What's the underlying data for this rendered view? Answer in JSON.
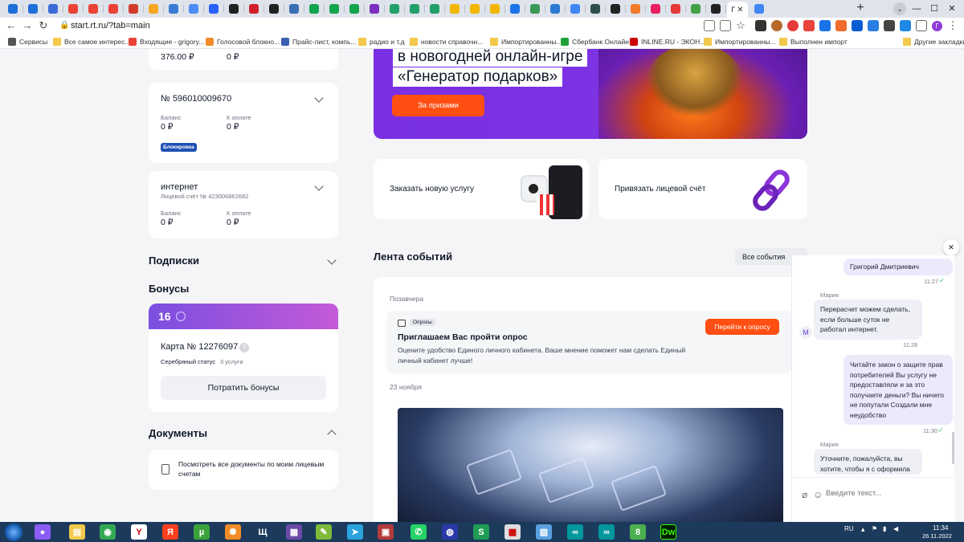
{
  "browser": {
    "url": "start.rt.ru/?tab=main",
    "active_tab_letter": "Г",
    "new_tab_label": "+",
    "tab_menu_label": "⌄",
    "win_min": "—",
    "win_max": "☐",
    "win_close": "✕",
    "avatar_letter": "Г",
    "tab_colors": [
      "#1d6fd8",
      "#1d6fd8",
      "#3b6bd4",
      "#ea4335",
      "#ea4335",
      "#ea4335",
      "#d23b2a",
      "#f5a623",
      "#3a7bd5",
      "#4c8bf5",
      "#2962ff",
      "#222222",
      "#d21f2c",
      "#222222",
      "#3c6eb4",
      "#14a44d",
      "#14a44d",
      "#14a44d",
      "#7b2fbf",
      "#22a06b",
      "#22a06b",
      "#22a06b",
      "#f2b500",
      "#f2b500",
      "#f2b500",
      "#1a73e8",
      "#3a9a55",
      "#2b7bd3",
      "#4285f4",
      "#2f4f4f",
      "#222222",
      "#f27b2a",
      "#e91e63",
      "#e53935",
      "#43a047",
      "#222222"
    ],
    "bookmarks": [
      {
        "label": "Сервисы"
      },
      {
        "label": "Все самое интерес..."
      },
      {
        "label": "Входящие - grigory..."
      },
      {
        "label": "Голосовой блокно..."
      },
      {
        "label": "Прайс-лист, компь..."
      },
      {
        "label": "радио и т.д"
      },
      {
        "label": "новости справочн..."
      },
      {
        "label": "Импортированны..."
      },
      {
        "label": "Сбербанк Онлайн"
      },
      {
        "label": "INLINE.RU - ЭКОН..."
      },
      {
        "label": "Импортированны..."
      },
      {
        "label": "Выполнен импорт"
      },
      {
        "label": "Другие закладки"
      }
    ]
  },
  "sidebar": {
    "acc0": {
      "balance": "376.00 ₽",
      "due": "0 ₽"
    },
    "acc1": {
      "title": "№ 596010009670",
      "balance_label": "Баланс",
      "due_label": "К оплате",
      "balance": "0 ₽",
      "due": "0 ₽",
      "badge": "Блокировка"
    },
    "acc2": {
      "title": "интернет",
      "subtitle": "Лицевой счёт № 423006862682",
      "balance_label": "Баланс",
      "due_label": "К оплате",
      "balance": "0 ₽",
      "due": "0 ₽"
    },
    "subscriptions": "Подписки",
    "bonuses": {
      "title": "Бонусы",
      "points": "16",
      "card": "Карта № 12276097",
      "help": "?",
      "status_label": "Серебряный статус",
      "status_value": "3 услуги",
      "spend_button": "Потратить бонусы"
    },
    "documents": {
      "title": "Документы",
      "link": "Посмотреть все документы по моим лицевым счетам"
    }
  },
  "promo": {
    "line1": "в новогодней онлайн-игре",
    "line2": "«Генератор подарков»",
    "button": "За призами"
  },
  "services": {
    "order": "Заказать новую услугу",
    "link_account": "Привязать лицевой счёт"
  },
  "feed": {
    "title": "Лента событий",
    "all_events": "Все события",
    "arrow": "→",
    "day1": "Позавчера",
    "survey": {
      "tag": "Опросы",
      "title": "Приглашаем Вас пройти опрос",
      "text": "Оцените удобство Единого личного кабинета. Ваше мнение поможет нам сделать Единый личный кабинет лучше!",
      "button": "Перейти к опросу"
    },
    "day2": "23 ноября"
  },
  "chat": {
    "close": "✕",
    "messages": [
      {
        "type": "out",
        "text": "Григорий Дмитриевич",
        "time": "11:27"
      },
      {
        "type": "in",
        "sender": "Мария",
        "text": "Перерасчет можем сделать, если больше суток не работал интернет.",
        "time": "11:28"
      },
      {
        "type": "out",
        "text": "Читайте закон о защите прав потребителей Вы услугу не предоставляли и за это получаете деньги? Вы ничего не попутали Создали мне неудобство",
        "time": "11:30"
      },
      {
        "type": "in",
        "sender": "Мария",
        "text": "Уточните, пожалуйста, вы хотите, чтобы я с оформила",
        "time": ""
      }
    ],
    "operator_initial": "М",
    "input_placeholder": "Введите текст..."
  },
  "taskbar": {
    "lang": "RU",
    "time": "11:34",
    "date": "26.11.2022",
    "icons": [
      {
        "name": "alice-icon",
        "color": "#8b5cf6",
        "glyph": "●"
      },
      {
        "name": "explorer-icon",
        "color": "#f3c94b",
        "glyph": "▤"
      },
      {
        "name": "chrome-icon",
        "color": "#34a853",
        "glyph": "◉"
      },
      {
        "name": "yandex-browser-icon",
        "color": "#ffffff",
        "glyph": "Y"
      },
      {
        "name": "yandex-icon",
        "color": "#fc3f1d",
        "glyph": "Я"
      },
      {
        "name": "utorrent-icon",
        "color": "#3ba33b",
        "glyph": "µ"
      },
      {
        "name": "xnview-icon",
        "color": "#f28c28",
        "glyph": "✺"
      },
      {
        "name": "app-u-icon",
        "color": "#1c3a5c",
        "glyph": "Щ"
      },
      {
        "name": "winrar-icon",
        "color": "#6b4aa8",
        "glyph": "▦"
      },
      {
        "name": "notepad-icon",
        "color": "#7fba3c",
        "glyph": "✎"
      },
      {
        "name": "telegram-icon",
        "color": "#2aa3df",
        "glyph": "➤"
      },
      {
        "name": "calculator-icon",
        "color": "#b23b3b",
        "glyph": "▣"
      },
      {
        "name": "whatsapp-icon",
        "color": "#25d366",
        "glyph": "✆"
      },
      {
        "name": "globe-icon",
        "color": "#2b3aa8",
        "glyph": "◍"
      },
      {
        "name": "s-app-icon",
        "color": "#1f9d55",
        "glyph": "S"
      },
      {
        "name": "qr-icon",
        "color": "#dddddd",
        "glyph": "▩"
      },
      {
        "name": "screen-icon",
        "color": "#5aa0e0",
        "glyph": "▧"
      },
      {
        "name": "arduino-icon",
        "color": "#00979d",
        "glyph": "∞"
      },
      {
        "name": "arduino2-icon",
        "color": "#00979d",
        "glyph": "∞"
      },
      {
        "name": "eight-icon",
        "color": "#4caf50",
        "glyph": "8"
      },
      {
        "name": "dreamweaver-icon",
        "color": "#35fa00",
        "glyph": "Dw"
      }
    ]
  }
}
